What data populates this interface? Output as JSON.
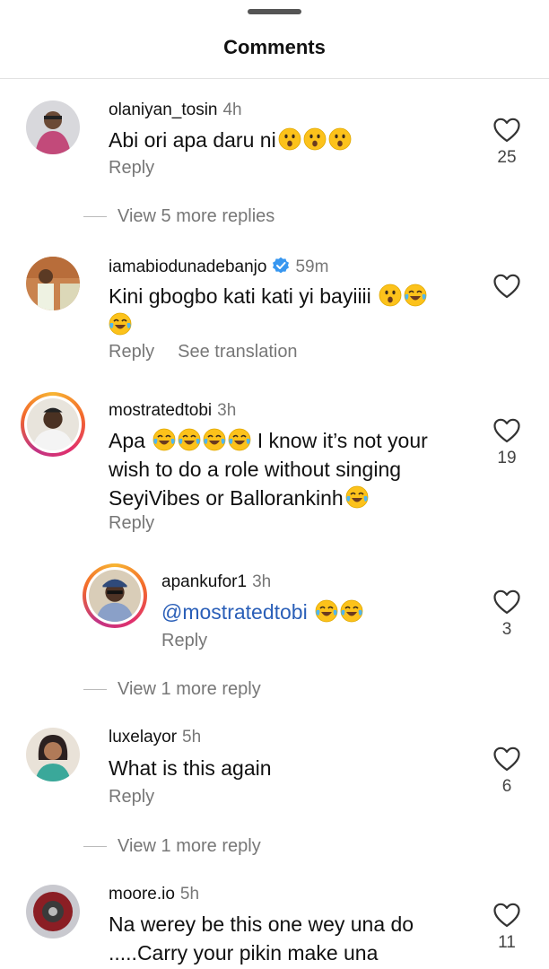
{
  "header": {
    "title": "Comments"
  },
  "comments": [
    {
      "user": "olaniyan_tosin",
      "time": "4h",
      "text": "Abi ori apa daru ni",
      "likes": "25",
      "reply": "Reply"
    },
    {
      "user": "iamabiodunadebanjo",
      "time": "59m",
      "text": "Kini gbogbo kati kati yi bayiiii",
      "likes": "",
      "reply": "Reply",
      "translate": "See translation"
    },
    {
      "user": "mostratedtobi",
      "time": "3h",
      "text": "Apa",
      "text2": " I know it’s not your wish to do a role without singing SeyiVibes or Ballorankinh",
      "likes": "19",
      "reply": "Reply"
    },
    {
      "user": "apankufor1",
      "time": "3h",
      "mention": "@mostratedtobi",
      "likes": "3",
      "reply": "Reply"
    },
    {
      "user": "luxelayor",
      "time": "5h",
      "text": "What is this again",
      "likes": "6",
      "reply": "Reply"
    },
    {
      "user": "moore.io",
      "time": "5h",
      "text": "Na werey be this one wey una do .....Carry your pikin make una",
      "likes": "11"
    }
  ],
  "more_replies": [
    "View 5 more replies",
    "View 1 more reply",
    "View 1 more reply"
  ],
  "colors": {
    "mention": "#2a5fb8",
    "verified": "#3897f0",
    "secondary_text": "#777777"
  },
  "icons": [
    "heart-outline-icon",
    "verified-badge-icon",
    "hushed-face-emoji",
    "laughing-tears-emoji"
  ]
}
